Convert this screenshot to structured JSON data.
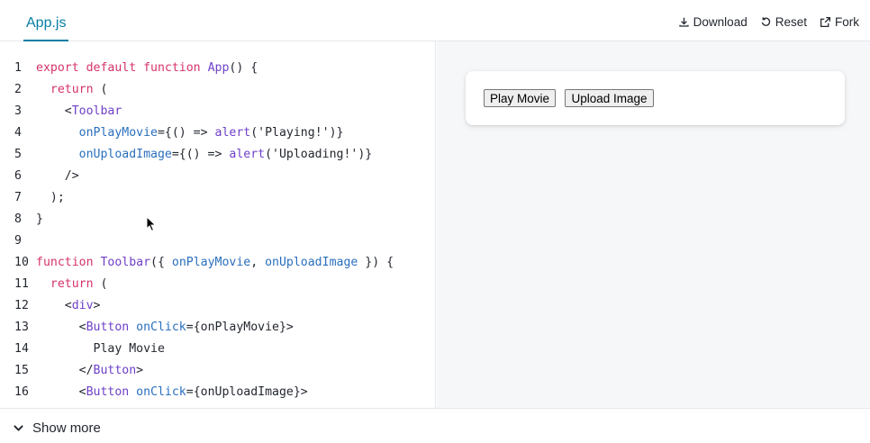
{
  "tab": {
    "label": "App.js"
  },
  "actions": {
    "download": "Download",
    "reset": "Reset",
    "fork": "Fork"
  },
  "code_lines": [
    {
      "n": "1",
      "tokens": [
        {
          "t": "export default function ",
          "c": "kw"
        },
        {
          "t": "App",
          "c": "fn"
        },
        {
          "t": "() {",
          "c": "pl"
        }
      ]
    },
    {
      "n": "2",
      "tokens": [
        {
          "t": "  ",
          "c": "pl"
        },
        {
          "t": "return",
          "c": "kw"
        },
        {
          "t": " (",
          "c": "pl"
        }
      ]
    },
    {
      "n": "3",
      "tokens": [
        {
          "t": "    <",
          "c": "pl"
        },
        {
          "t": "Toolbar",
          "c": "tag"
        }
      ]
    },
    {
      "n": "4",
      "tokens": [
        {
          "t": "      ",
          "c": "pl"
        },
        {
          "t": "onPlayMovie",
          "c": "at"
        },
        {
          "t": "={() => ",
          "c": "pl"
        },
        {
          "t": "alert",
          "c": "fn"
        },
        {
          "t": "(",
          "c": "pl"
        },
        {
          "t": "'Playing!'",
          "c": "pl"
        },
        {
          "t": ")}",
          "c": "pl"
        }
      ]
    },
    {
      "n": "5",
      "tokens": [
        {
          "t": "      ",
          "c": "pl"
        },
        {
          "t": "onUploadImage",
          "c": "at"
        },
        {
          "t": "={() => ",
          "c": "pl"
        },
        {
          "t": "alert",
          "c": "fn"
        },
        {
          "t": "(",
          "c": "pl"
        },
        {
          "t": "'Uploading!'",
          "c": "pl"
        },
        {
          "t": ")}",
          "c": "pl"
        }
      ]
    },
    {
      "n": "6",
      "tokens": [
        {
          "t": "    />",
          "c": "pl"
        }
      ]
    },
    {
      "n": "7",
      "tokens": [
        {
          "t": "  );",
          "c": "pl"
        }
      ]
    },
    {
      "n": "8",
      "tokens": [
        {
          "t": "}",
          "c": "pl"
        }
      ]
    },
    {
      "n": "9",
      "tokens": [
        {
          "t": "",
          "c": "pl"
        }
      ]
    },
    {
      "n": "10",
      "tokens": [
        {
          "t": "function ",
          "c": "kw"
        },
        {
          "t": "Toolbar",
          "c": "fn"
        },
        {
          "t": "({ ",
          "c": "pl"
        },
        {
          "t": "onPlayMovie",
          "c": "at"
        },
        {
          "t": ", ",
          "c": "pl"
        },
        {
          "t": "onUploadImage",
          "c": "at"
        },
        {
          "t": " }) {",
          "c": "pl"
        }
      ]
    },
    {
      "n": "11",
      "tokens": [
        {
          "t": "  ",
          "c": "pl"
        },
        {
          "t": "return",
          "c": "kw"
        },
        {
          "t": " (",
          "c": "pl"
        }
      ]
    },
    {
      "n": "12",
      "tokens": [
        {
          "t": "    <",
          "c": "pl"
        },
        {
          "t": "div",
          "c": "tag"
        },
        {
          "t": ">",
          "c": "pl"
        }
      ]
    },
    {
      "n": "13",
      "tokens": [
        {
          "t": "      <",
          "c": "pl"
        },
        {
          "t": "Button",
          "c": "tag"
        },
        {
          "t": " ",
          "c": "pl"
        },
        {
          "t": "onClick",
          "c": "at"
        },
        {
          "t": "={onPlayMovie}>",
          "c": "pl"
        }
      ]
    },
    {
      "n": "14",
      "tokens": [
        {
          "t": "        Play Movie",
          "c": "pl"
        }
      ]
    },
    {
      "n": "15",
      "tokens": [
        {
          "t": "      </",
          "c": "pl"
        },
        {
          "t": "Button",
          "c": "tag"
        },
        {
          "t": ">",
          "c": "pl"
        }
      ]
    },
    {
      "n": "16",
      "tokens": [
        {
          "t": "      <",
          "c": "pl"
        },
        {
          "t": "Button",
          "c": "tag"
        },
        {
          "t": " ",
          "c": "pl"
        },
        {
          "t": "onClick",
          "c": "at"
        },
        {
          "t": "={onUploadImage}>",
          "c": "pl"
        }
      ]
    }
  ],
  "preview": {
    "play_button": "Play Movie",
    "upload_button": "Upload Image"
  },
  "footer": {
    "show_more": "Show more"
  }
}
